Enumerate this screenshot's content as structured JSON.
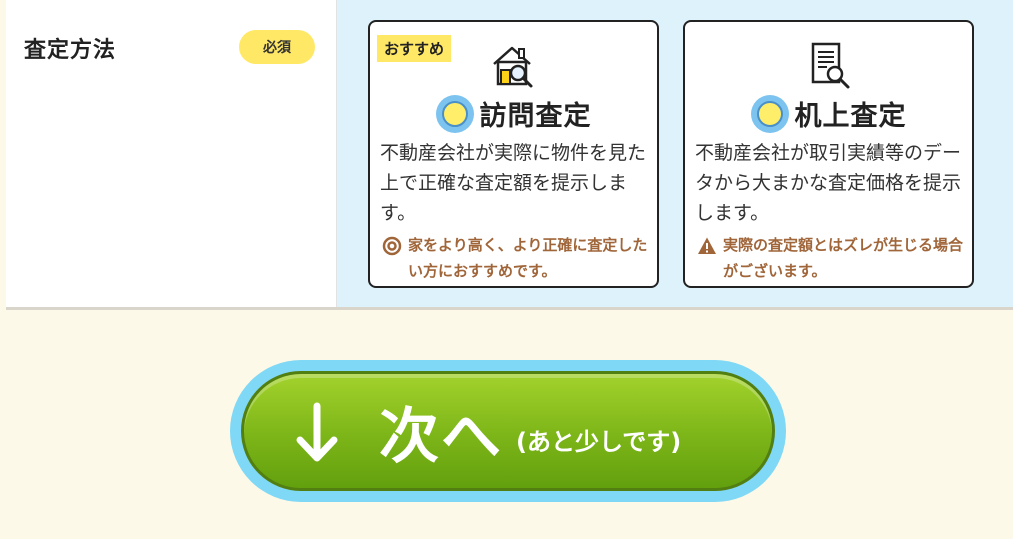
{
  "form": {
    "label": "査定方法",
    "required_badge": "必須"
  },
  "options": {
    "visit": {
      "tag": "おすすめ",
      "title": "訪問査定",
      "description": "不動産会社が実際に物件を見た上で正確な査定額を提示します。",
      "note": "家をより高く、より正確に査定したい方におすすめです。",
      "icon": "house-search-icon",
      "note_icon": "double-circle-icon"
    },
    "desk": {
      "title": "机上査定",
      "description": "不動産会社が取引実績等のデータから大まかな査定価格を提示します。",
      "note": "実際の査定額とはズレが生じる場合がございます。",
      "icon": "document-search-icon",
      "note_icon": "warning-icon"
    }
  },
  "next_button": {
    "label": "次へ",
    "sub_label": "(あと少しです)",
    "icon": "arrow-down-icon"
  },
  "colors": {
    "accent_yellow": "#ffe866",
    "option_bg": "#def2fb",
    "note_brown": "#a0663a",
    "button_green": "#7cb518",
    "button_ring": "#7fd8f5"
  }
}
